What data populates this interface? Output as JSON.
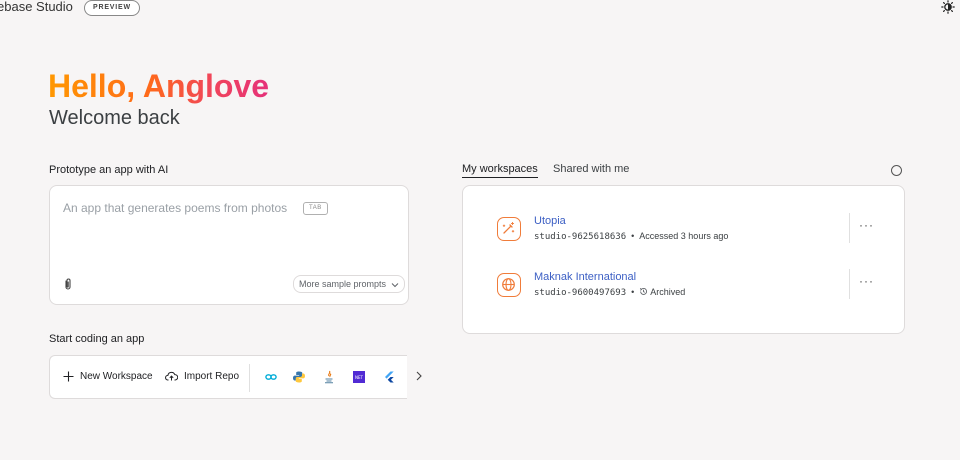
{
  "header": {
    "brand": "ebase Studio",
    "badge": "PREVIEW",
    "theme_icon": "brightness-icon"
  },
  "hero": {
    "greeting": "Hello, Anglove",
    "subtitle": "Welcome back"
  },
  "prototype": {
    "label": "Prototype an app with AI",
    "placeholder": "An app that generates poems from photos",
    "tab_hint": "TAB",
    "attach_icon": "paperclip-icon",
    "sample_button": "More sample prompts",
    "sample_icon": "chevron-down-icon"
  },
  "coding": {
    "label": "Start coding an app",
    "new_workspace": "New Workspace",
    "import_repo": "Import Repo",
    "templates": [
      {
        "icon": "go-icon",
        "color": "#00acd7"
      },
      {
        "icon": "python-icon",
        "color": "#3776ab"
      },
      {
        "icon": "java-icon",
        "color": "#e76f00"
      },
      {
        "icon": "dotnet-icon",
        "color": "#512bd4"
      },
      {
        "icon": "flutter-icon",
        "color": "#02569b"
      }
    ],
    "next_icon": "chevron-right-icon"
  },
  "workspaces": {
    "tabs": [
      {
        "label": "My workspaces",
        "active": true
      },
      {
        "label": "Shared with me",
        "active": false
      }
    ],
    "items": [
      {
        "name": "Utopia",
        "id": "studio-9625618636",
        "status": "Accessed 3 hours ago",
        "icon": "magic-wand-icon",
        "archived": false
      },
      {
        "name": "Maknak International",
        "id": "studio-9600497693",
        "status": "Archived",
        "icon": "globe-icon",
        "archived": true
      }
    ],
    "more_label": "···",
    "separator": "•"
  },
  "colors": {
    "accent": "#3c5fc4",
    "workspace_icon_border": "#f07c3a",
    "background": "#f7f5f5"
  }
}
